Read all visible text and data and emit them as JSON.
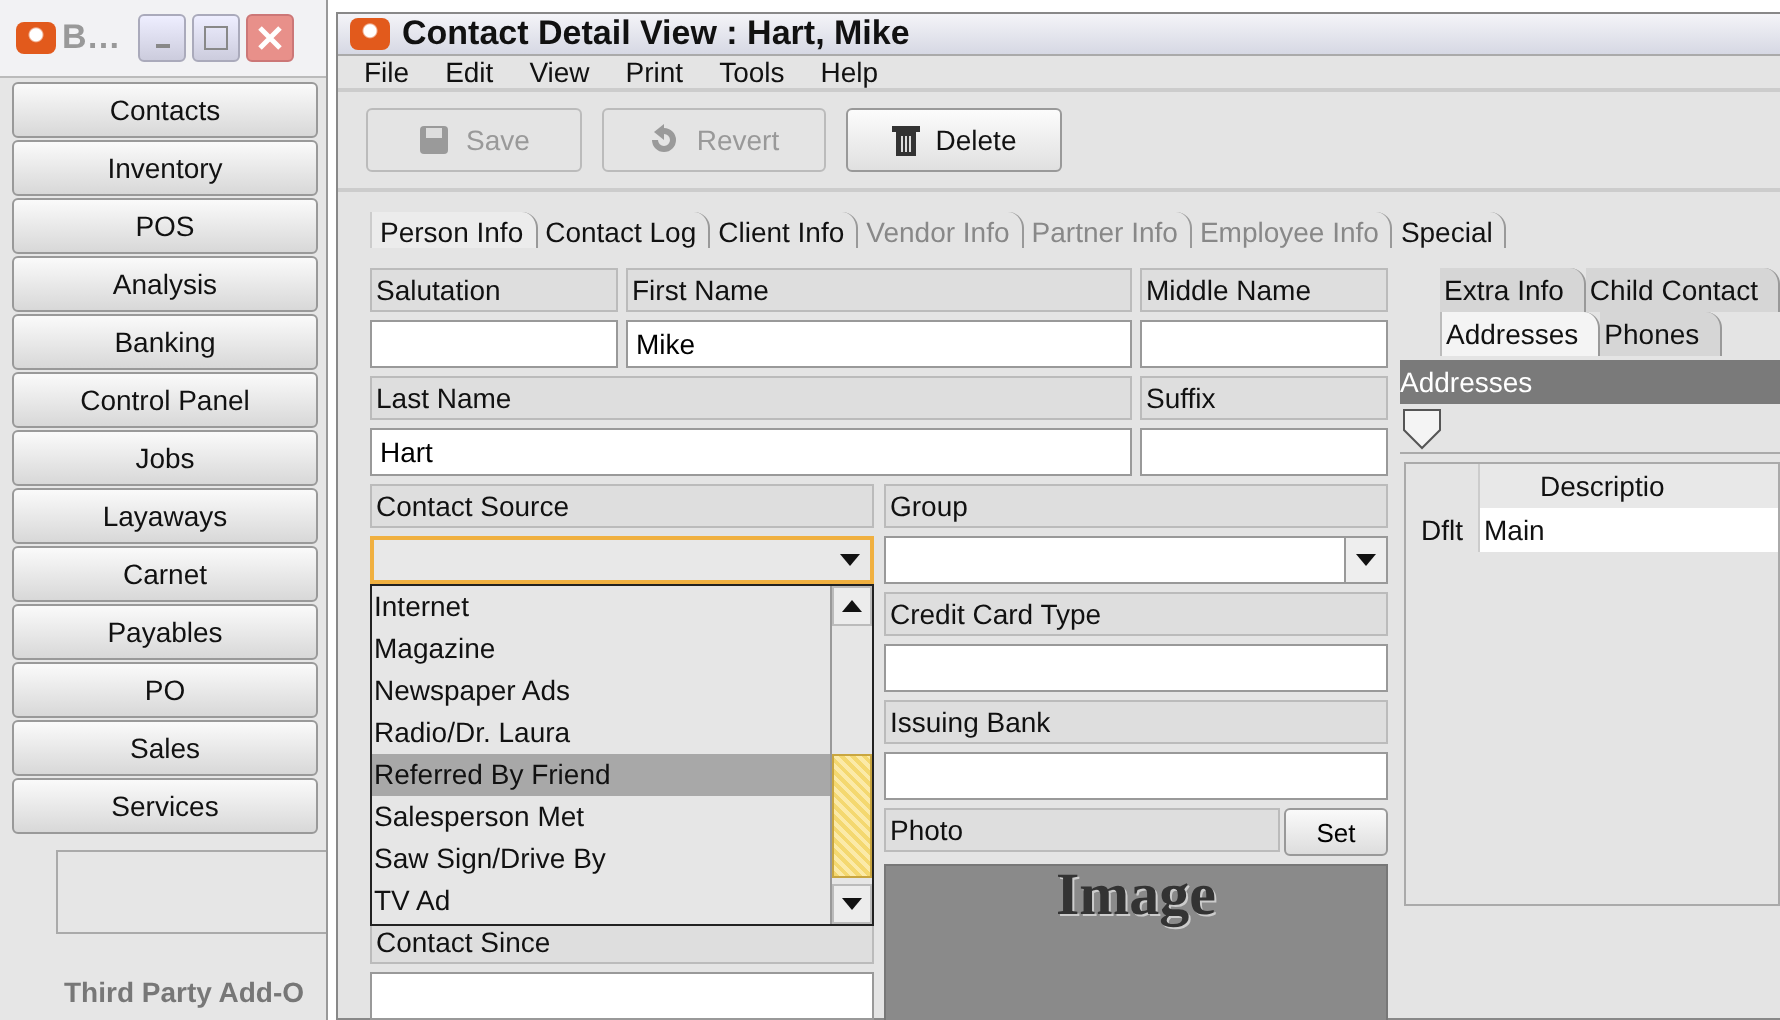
{
  "back_window": {
    "title": "B…",
    "nav": [
      {
        "label": "Contacts"
      },
      {
        "label": "Inventory"
      },
      {
        "label": "POS"
      },
      {
        "label": "Analysis"
      },
      {
        "label": "Banking"
      },
      {
        "label": "Control Panel"
      },
      {
        "label": "Jobs"
      },
      {
        "label": "Layaways"
      },
      {
        "label": "Carnet"
      },
      {
        "label": "Payables"
      },
      {
        "label": "PO"
      },
      {
        "label": "Sales"
      },
      {
        "label": "Services"
      }
    ],
    "group_title": "Third Party Add-O"
  },
  "window": {
    "title": "Contact Detail View : Hart, Mike"
  },
  "menu": [
    "File",
    "Edit",
    "View",
    "Print",
    "Tools",
    "Help"
  ],
  "toolbar": [
    {
      "label": "Save",
      "kind": "save",
      "disabled": true
    },
    {
      "label": "Revert",
      "kind": "revert",
      "disabled": true
    },
    {
      "label": "Delete",
      "kind": "delete",
      "disabled": false
    }
  ],
  "tabs": [
    {
      "label": "Person Info",
      "selected": true,
      "disabled": false
    },
    {
      "label": "Contact Log",
      "selected": false,
      "disabled": false
    },
    {
      "label": "Client Info",
      "selected": false,
      "disabled": false
    },
    {
      "label": "Vendor Info",
      "selected": false,
      "disabled": true
    },
    {
      "label": "Partner Info",
      "selected": false,
      "disabled": true
    },
    {
      "label": "Employee Info",
      "selected": false,
      "disabled": true
    },
    {
      "label": "Special",
      "selected": false,
      "disabled": false
    }
  ],
  "form": {
    "salutation": {
      "label": "Salutation"
    },
    "first_name": {
      "label": "First Name",
      "value": "Mike"
    },
    "middle_name": {
      "label": "Middle Name"
    },
    "last_name": {
      "label": "Last Name",
      "value": "Hart"
    },
    "suffix": {
      "label": "Suffix"
    },
    "contact_source": {
      "label": "Contact Source",
      "open": true,
      "options": [
        {
          "label": "Internet",
          "selected": false
        },
        {
          "label": "Magazine",
          "selected": false
        },
        {
          "label": "Newspaper Ads",
          "selected": false
        },
        {
          "label": "Radio/Dr. Laura",
          "selected": false
        },
        {
          "label": "Referred By Friend",
          "selected": true
        },
        {
          "label": "Salesperson Met",
          "selected": false
        },
        {
          "label": "Saw Sign/Drive By",
          "selected": false
        },
        {
          "label": "TV Ad",
          "selected": false
        }
      ]
    },
    "group": {
      "label": "Group"
    },
    "credit_card_type": {
      "label": "Credit Card Type"
    },
    "issuing_bank": {
      "label": "Issuing Bank"
    },
    "photo": {
      "label": "Photo",
      "button": "Set",
      "placeholder_text": "Image"
    },
    "contact_since": {
      "label": "Contact Since"
    }
  },
  "side_panel": {
    "tabs_row_1": [
      {
        "label": "Extra Info",
        "selected": false
      },
      {
        "label": "Child Contact",
        "selected": false
      }
    ],
    "tabs_row_2": [
      {
        "label": "Addresses",
        "selected": true
      },
      {
        "label": "Phones",
        "selected": false
      }
    ],
    "header": "Addresses",
    "table": {
      "columns": [
        "Descriptio"
      ],
      "rows": [
        {
          "flag": "Dflt",
          "description": "Main"
        }
      ]
    }
  }
}
